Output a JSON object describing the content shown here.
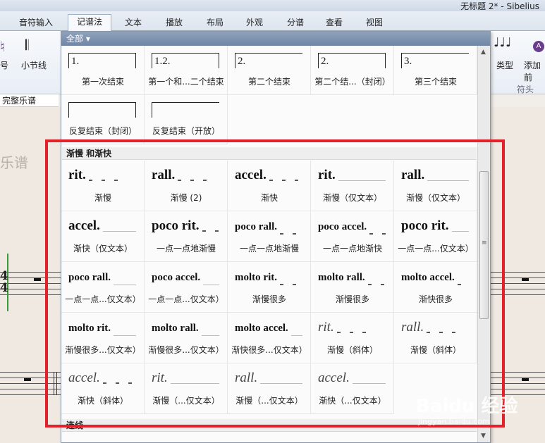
{
  "window": {
    "title": "无标题 2* - Sibelius"
  },
  "ribbon_tabs": [
    "音符输入",
    "记谱法",
    "文本",
    "播放",
    "布局",
    "外观",
    "分谱",
    "查看",
    "视图"
  ],
  "ribbon": {
    "left_label_1": "号",
    "left_label_2": "小节线",
    "type_label": "类型",
    "add_label": "添加前",
    "notehead_group": "符头",
    "subbar": "完整乐谱"
  },
  "score": {
    "faint_title": "乐谱"
  },
  "gallery": {
    "header": "全部 ▾",
    "endings": [
      {
        "mark": "1.",
        "caption": "第一次结束",
        "open": false
      },
      {
        "mark": "1.2.",
        "caption": "第一个和...二个结束",
        "open": false
      },
      {
        "mark": "2.",
        "caption": "第二个结束",
        "open": true
      },
      {
        "mark": "2.",
        "caption": "第二个结...（封闭）",
        "open": false
      },
      {
        "mark": "3.",
        "caption": "第三个结束",
        "open": true
      },
      {
        "mark": "",
        "caption": "反复结束（封闭）",
        "open": false
      },
      {
        "mark": "",
        "caption": "反复结束（开放）",
        "open": true
      }
    ],
    "section_tempo": "渐慢 和渐快",
    "section_bottom": "连线",
    "tempo_cells": [
      {
        "text": "rit.",
        "caption": "渐慢",
        "style": "dashed"
      },
      {
        "text": "rall.",
        "caption": "渐慢 (2)",
        "style": "dashed"
      },
      {
        "text": "accel.",
        "caption": "渐快",
        "style": "dashed"
      },
      {
        "text": "rit.",
        "caption": "渐慢（仅文本）",
        "style": "line"
      },
      {
        "text": "rall.",
        "caption": "渐慢（仅文本）",
        "style": "line"
      },
      {
        "text": "accel.",
        "caption": "渐快（仅文本）",
        "style": "line"
      },
      {
        "text": "poco rit.",
        "caption": "一点一点地渐慢",
        "style": "dashed"
      },
      {
        "text": "poco rall.",
        "caption": "一点一点地渐慢",
        "style": "dashed",
        "small": true
      },
      {
        "text": "poco accel.",
        "caption": "一点一点地渐快",
        "style": "dashed",
        "small": true
      },
      {
        "text": "poco rit.",
        "caption": "一点一点...仅文本）",
        "style": "line"
      },
      {
        "text": "poco rall.",
        "caption": "一点一点...仅文本）",
        "style": "line",
        "small": true
      },
      {
        "text": "poco accel.",
        "caption": "一点一点...仅文本）",
        "style": "line",
        "small": true
      },
      {
        "text": "molto rit.",
        "caption": "渐慢很多",
        "style": "dashed",
        "small": true
      },
      {
        "text": "molto rall.",
        "caption": "渐慢很多",
        "style": "dashed",
        "small": true
      },
      {
        "text": "molto accel.",
        "caption": "渐快很多",
        "style": "dashed",
        "small": true
      },
      {
        "text": "molto rit.",
        "caption": "渐慢很多...仅文本）",
        "style": "line",
        "small": true
      },
      {
        "text": "molto rall.",
        "caption": "渐慢很多...仅文本）",
        "style": "line",
        "small": true
      },
      {
        "text": "molto accel.",
        "caption": "渐快很多...仅文本）",
        "style": "line",
        "small": true
      },
      {
        "text": "rit.",
        "caption": "渐慢（斜体）",
        "style": "dashed",
        "italic": true
      },
      {
        "text": "rall.",
        "caption": "渐慢（斜体）",
        "style": "dashed",
        "italic": true
      },
      {
        "text": "accel.",
        "caption": "渐快（斜体）",
        "style": "dashed",
        "italic": true
      },
      {
        "text": "rit.",
        "caption": "渐慢（...仅文本）",
        "style": "line",
        "italic": true
      },
      {
        "text": "rall.",
        "caption": "渐慢（...仅文本）",
        "style": "line",
        "italic": true
      },
      {
        "text": "accel.",
        "caption": "渐快（...仅文本）",
        "style": "line",
        "italic": true
      }
    ]
  },
  "watermark": {
    "logo": "Baidu 经验",
    "url": "jingyan.baidu.com"
  },
  "colors": {
    "highlight": "#e2212b",
    "gallery_header": "#7d92ae"
  }
}
